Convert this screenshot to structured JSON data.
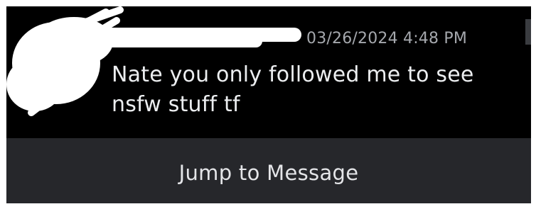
{
  "message": {
    "timestamp": "03/26/2024 4:48 PM",
    "text_line1": "Nate you only followed me to see",
    "text_line2": "nsfw stuff tf"
  },
  "jump": {
    "label": "Jump to Message"
  },
  "colors": {
    "card_bg": "#000000",
    "jump_bg": "#26272b",
    "timestamp": "#a5a8ad",
    "text": "#eceef0",
    "redaction": "#ffffff"
  }
}
